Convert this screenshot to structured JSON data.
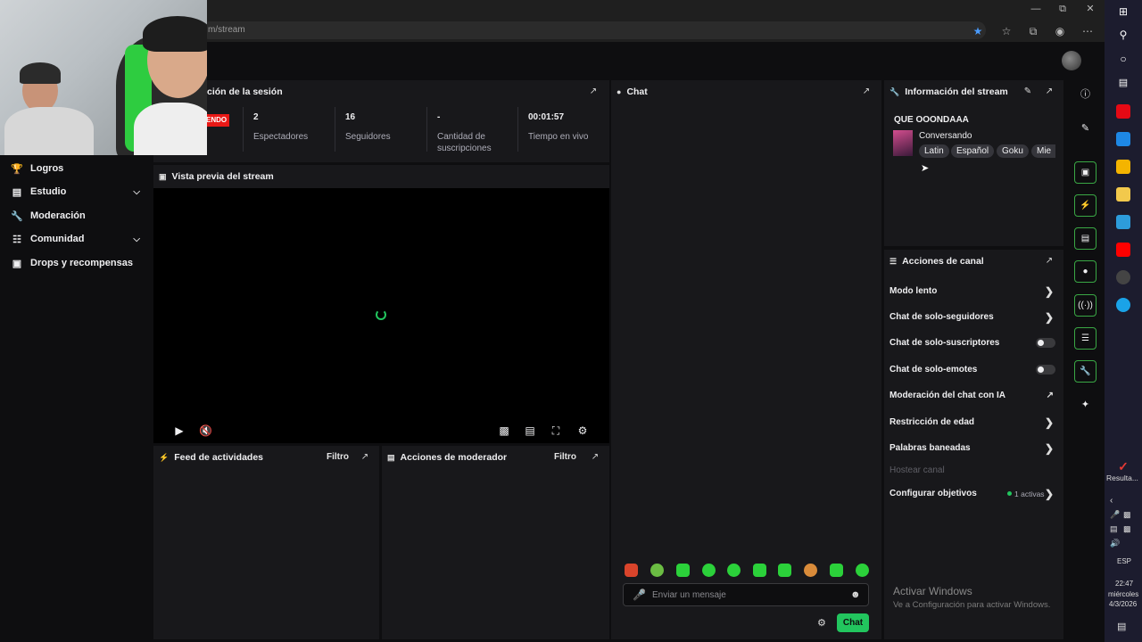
{
  "browser": {
    "url": "m/stream",
    "window_controls": [
      "minimize-icon",
      "restore-icon",
      "close-icon"
    ],
    "toolbar_icons": [
      "star-icon",
      "favorites-icon",
      "collections-icon",
      "profile-icon",
      "more-icon"
    ]
  },
  "sidebar": {
    "items": [
      {
        "label": "Logros",
        "icon": "trophy-icon",
        "expandable": false
      },
      {
        "label": "Estudio",
        "icon": "studio-icon",
        "expandable": true
      },
      {
        "label": "Moderación",
        "icon": "wrench-icon",
        "expandable": false
      },
      {
        "label": "Comunidad",
        "icon": "community-icon",
        "expandable": true
      },
      {
        "label": "Drops y recompensas",
        "icon": "gift-icon",
        "expandable": false
      }
    ]
  },
  "session": {
    "title": "ción de la sesión",
    "live_badge": "ENDO",
    "stats": [
      {
        "value": "2",
        "label": "Espectadores"
      },
      {
        "value": "16",
        "label": "Seguidores"
      },
      {
        "value": "-",
        "label": "Cantidad de suscripciones"
      },
      {
        "value": "00:01:57",
        "label": "Tiempo en vivo"
      }
    ]
  },
  "preview": {
    "title": "Vista previa del stream"
  },
  "activity": {
    "title": "Feed de actividades",
    "filter": "Filtro"
  },
  "mod_actions": {
    "title": "Acciones de moderador",
    "filter": "Filtro"
  },
  "chat": {
    "title": "Chat",
    "placeholder": "Enviar un mensaje",
    "send_label": "Chat"
  },
  "stream_info": {
    "title": "Información del stream",
    "stream_title": "QUE OOONDAAA",
    "category": "Conversando",
    "tags": [
      "Latin",
      "Español",
      "Goku",
      "Mie"
    ]
  },
  "channel_actions": {
    "title": "Acciones de canal",
    "items": [
      {
        "label": "Modo lento",
        "control": "arrow"
      },
      {
        "label": "Chat de solo-seguidores",
        "control": "arrow"
      },
      {
        "label": "Chat de solo-suscriptores",
        "control": "toggle"
      },
      {
        "label": "Chat de solo-emotes",
        "control": "toggle"
      },
      {
        "label": "Moderación del chat con IA",
        "control": "external"
      },
      {
        "label": "Restricción de edad",
        "control": "arrow"
      },
      {
        "label": "Palabras baneadas",
        "control": "arrow"
      },
      {
        "label": "Hostear canal",
        "control": "disabled"
      },
      {
        "label": "Configurar objetivos",
        "control": "arrow"
      }
    ],
    "goals_active": "1 activas"
  },
  "windows": {
    "activate_title": "Activar Windows",
    "activate_sub": "Ve a Configuración para activar Windows.",
    "taskbar_label": "Resulta...",
    "lang": "ESP",
    "time": "22:47",
    "day": "miércoles",
    "date": "4/3/2026"
  },
  "colors": {
    "accent_green": "#22c55e",
    "live_red": "#e91916",
    "panel_bg": "#18181b",
    "page_bg": "#0e0e10"
  }
}
